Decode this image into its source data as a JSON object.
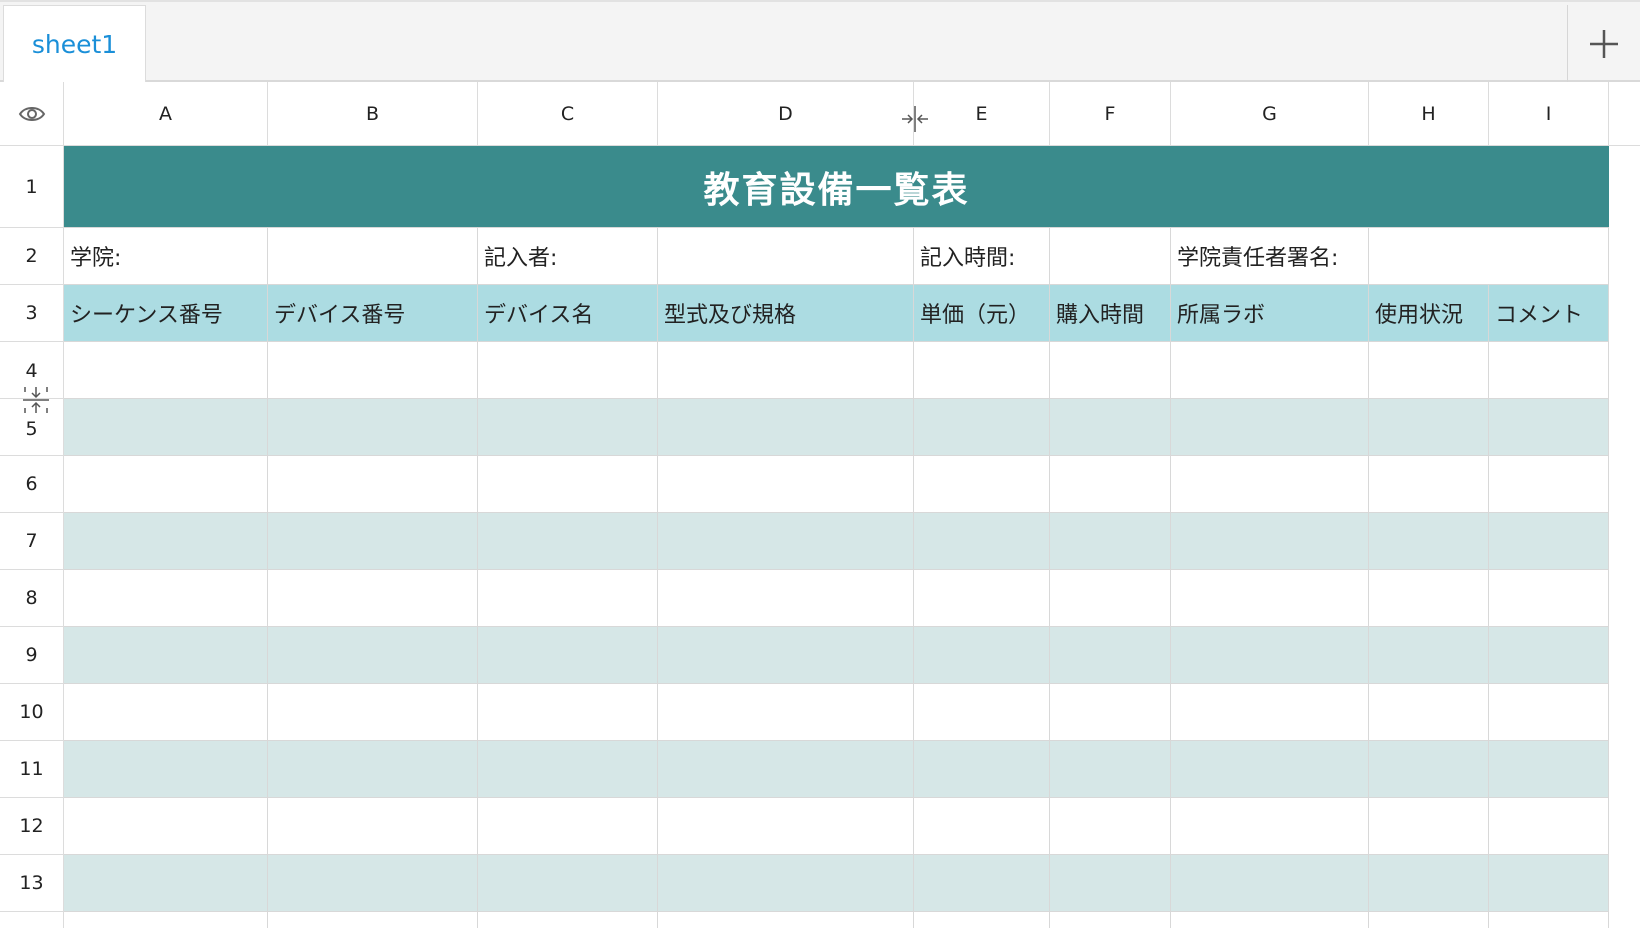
{
  "tabs": [
    {
      "label": "sheet1",
      "active": true
    }
  ],
  "columns": [
    "A",
    "B",
    "C",
    "D",
    "E",
    "F",
    "G",
    "H",
    "I"
  ],
  "rows": [
    "1",
    "2",
    "3",
    "4",
    "5",
    "6",
    "7",
    "8",
    "9",
    "10",
    "11",
    "12",
    "13"
  ],
  "title": "教育設備一覧表",
  "info_row": {
    "college_label": "学院:",
    "recorder_label": "記入者:",
    "record_time_label": "記入時間:",
    "signature_label": "学院責任者署名:"
  },
  "headers": [
    "シーケンス番号",
    "デバイス番号",
    "デバイス名",
    "型式及び規格",
    "単価（元）",
    "購入時間",
    "所属ラボ",
    "使用状況",
    "コメント"
  ],
  "colors": {
    "title_bg": "#3a8b8c",
    "header_bg": "#acdce2",
    "band_bg": "#d6e7e7",
    "tab_text": "#1a8fd8"
  },
  "icons": {
    "add": "plus-icon",
    "visibility": "eye-icon",
    "col_resize": "column-resize-icon",
    "row_resize": "row-resize-icon"
  }
}
